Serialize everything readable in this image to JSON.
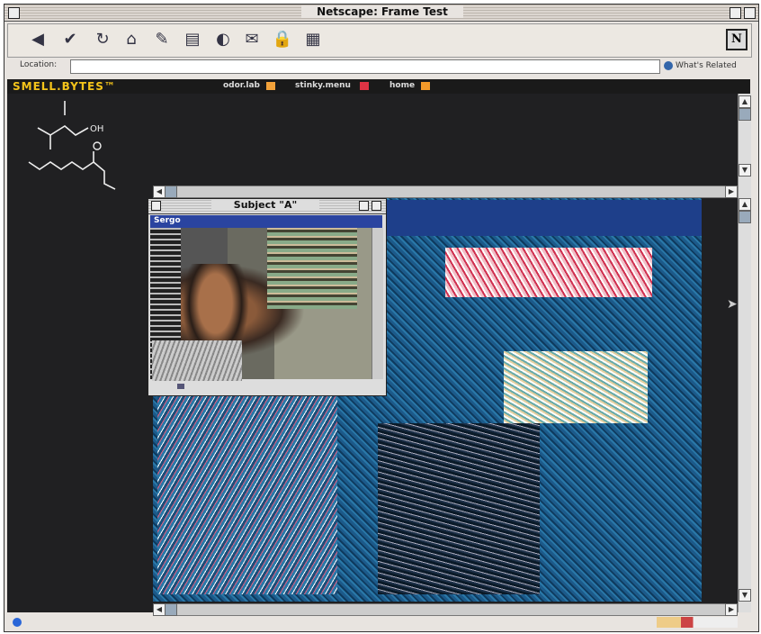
{
  "window": {
    "title": "Netscape: Frame Test"
  },
  "toolbar": {
    "buttons": [
      {
        "name": "back-icon",
        "glyph": "◀"
      },
      {
        "name": "forward-icon",
        "glyph": "✔"
      },
      {
        "name": "reload-icon",
        "glyph": "↻"
      },
      {
        "name": "home-icon",
        "glyph": "⌂"
      },
      {
        "name": "search-icon",
        "glyph": "✎"
      },
      {
        "name": "guide-icon",
        "glyph": "▤"
      },
      {
        "name": "images-icon",
        "glyph": "◐"
      },
      {
        "name": "print-icon",
        "glyph": "✉"
      },
      {
        "name": "security-icon",
        "glyph": "🔒"
      },
      {
        "name": "stop-icon",
        "glyph": "▦"
      }
    ],
    "logo": "N"
  },
  "location": {
    "label": "Location:",
    "related": "What's Related"
  },
  "nav": {
    "brand": "SMELL.BYTES™",
    "links": [
      {
        "label": "odor.lab"
      },
      {
        "label": "stinky.menu"
      },
      {
        "label": "home"
      }
    ]
  },
  "subwindow": {
    "title": "Subject \"A\"",
    "label": "Sergo"
  },
  "colors": {
    "brand": "#f4c41a",
    "content_bg": "#202022",
    "blue_bar": "#2a44a0"
  }
}
